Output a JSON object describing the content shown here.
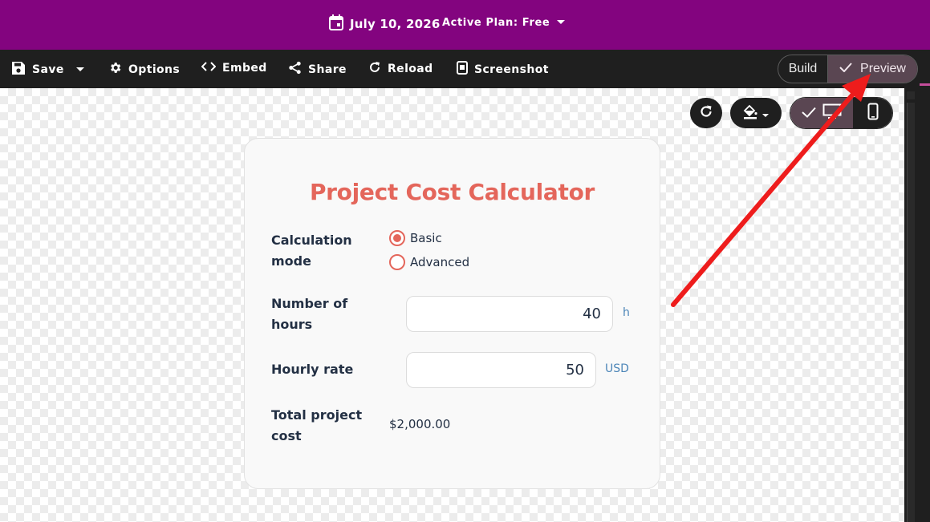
{
  "header": {
    "date": "July 10, 2026",
    "plan": "Active Plan: Free"
  },
  "toolbar": {
    "save": "Save",
    "options": "Options",
    "embed": "Embed",
    "share": "Share",
    "reload": "Reload",
    "screenshot": "Screenshot",
    "mode_toggle": {
      "build": "Build",
      "preview": "Preview",
      "active": "Preview"
    }
  },
  "card": {
    "title": "Project Cost Calculator",
    "calculation_mode": {
      "label": "Calculation mode",
      "options": [
        "Basic",
        "Advanced"
      ],
      "selected": "Basic"
    },
    "hours": {
      "label": "Number of hours",
      "value": "40",
      "unit": "h"
    },
    "rate": {
      "label": "Hourly rate",
      "value": "50",
      "unit": "USD"
    },
    "total": {
      "label": "Total project cost",
      "value": "$2,000.00"
    }
  },
  "colors": {
    "brand_purple": "#83047f",
    "toolbar_dark": "#1f1f1f",
    "accent_coral": "#e4665b",
    "annotation_red": "#ee1c1c"
  },
  "icons": [
    "calendar-icon",
    "chevron-down-icon",
    "save-icon",
    "gear-icon",
    "code-icon",
    "share-icon",
    "reload-icon",
    "screenshot-icon",
    "check-icon",
    "refresh-icon",
    "paint-bucket-icon",
    "desktop-icon",
    "phone-icon"
  ]
}
